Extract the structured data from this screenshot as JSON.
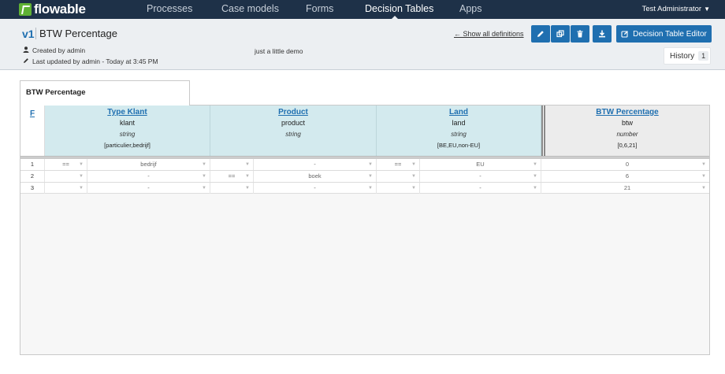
{
  "nav": {
    "logo": "flowable",
    "items": [
      {
        "label": "Processes"
      },
      {
        "label": "Case models"
      },
      {
        "label": "Forms"
      },
      {
        "label": "Decision Tables"
      },
      {
        "label": "Apps"
      }
    ],
    "active_index": 3,
    "user": "Test Administrator"
  },
  "header": {
    "version": "v1",
    "title": "BTW Percentage",
    "created_by": "Created by admin",
    "last_updated": "Last updated by admin - Today at 3:45 PM",
    "description": "just a little demo",
    "show_all_link": "← Show all definitions",
    "editor_button": "Decision Table Editor",
    "history_label": "History",
    "history_count": "1"
  },
  "table": {
    "tab_title": "BTW Percentage",
    "hit_policy": "F",
    "inputs": [
      {
        "label": "Type Klant",
        "variable": "klant",
        "type": "string",
        "values": "[particulier,bedrijf]"
      },
      {
        "label": "Product",
        "variable": "product",
        "type": "string",
        "values": ""
      },
      {
        "label": "Land",
        "variable": "land",
        "type": "string",
        "values": "[BE,EU,non-EU]"
      }
    ],
    "output": {
      "label": "BTW Percentage",
      "variable": "btw",
      "type": "number",
      "values": "[0,6,21]"
    },
    "rows": [
      {
        "num": "1",
        "in1_op": "==",
        "in1_val": "bedrijf",
        "in2_op": "",
        "in2_val": "-",
        "in3_op": "==",
        "in3_val": "EU",
        "out": "0"
      },
      {
        "num": "2",
        "in1_op": "",
        "in1_val": "-",
        "in2_op": "==",
        "in2_val": "boek",
        "in3_op": "",
        "in3_val": "-",
        "out": "6"
      },
      {
        "num": "3",
        "in1_op": "",
        "in1_val": "-",
        "in2_op": "",
        "in2_val": "-",
        "in3_op": "",
        "in3_val": "-",
        "out": "21"
      }
    ]
  },
  "colors": {
    "nav_bg": "#1e3148",
    "accent": "#1f6fb0",
    "input_header": "#d3eaee",
    "logo_green": "#5fb134"
  }
}
